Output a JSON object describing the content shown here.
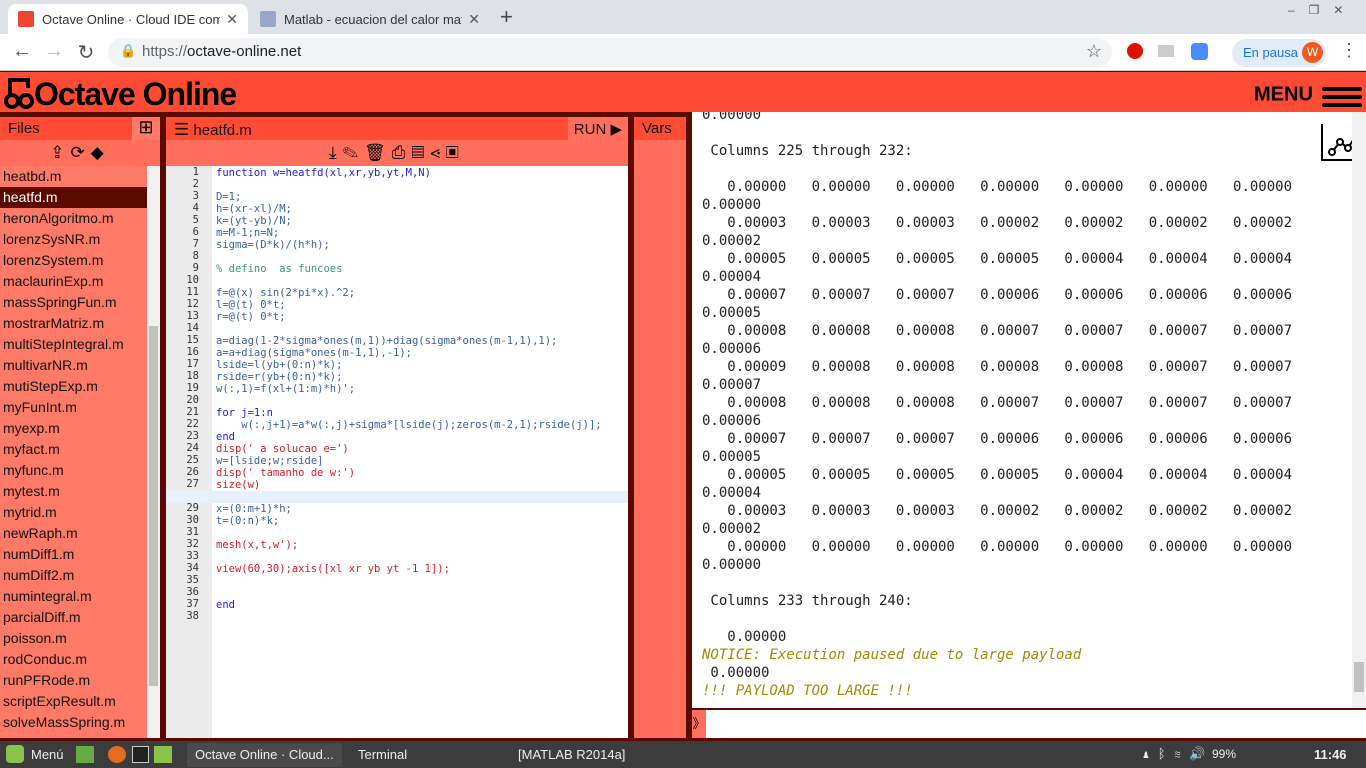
{
  "browser": {
    "tabs": [
      {
        "title": "Octave Online · Cloud IDE comp",
        "active": true
      },
      {
        "title": "Matlab - ecuacion del calor mat",
        "active": false
      }
    ],
    "url_scheme": "https://",
    "url_host": "octave-online.net",
    "profile_status": "En pausa",
    "avatar_letter": "W"
  },
  "app": {
    "logo": "Octave Online",
    "menu_label": "MENU",
    "accent": "#ff4b33"
  },
  "files": {
    "title": "Files",
    "items": [
      "heatbd.m",
      "heatfd.m",
      "heronAlgoritmo.m",
      "lorenzSysNR.m",
      "lorenzSystem.m",
      "maclaurinExp.m",
      "massSpringFun.m",
      "mostrarMatriz.m",
      "multiStepIntegral.m",
      "multivarNR.m",
      "mutiStepExp.m",
      "myFunInt.m",
      "myexp.m",
      "myfact.m",
      "myfunc.m",
      "mytest.m",
      "mytrid.m",
      "newRaph.m",
      "numDiff1.m",
      "numDiff2.m",
      "numintegral.m",
      "parcialDiff.m",
      "poisson.m",
      "rodConduc.m",
      "runPFRode.m",
      "scriptExpResult.m",
      "solveMassSpring.m"
    ],
    "selected": "heatfd.m"
  },
  "editor": {
    "filename": "heatfd.m",
    "run_label": "RUN",
    "current_line": 28,
    "lines": [
      "function w=heatfd(xl,xr,yb,yt,M,N)",
      "",
      "D=1;",
      "h=(xr-xl)/M;",
      "k=(yt-yb)/N;",
      "m=M-1;n=N;",
      "sigma=(D*k)/(h*h);",
      "",
      "% defino  as funcoes",
      "",
      "f=@(x) sin(2*pi*x).^2;",
      "l=@(t) 0*t;",
      "r=@(t) 0*t;",
      "",
      "a=diag(1-2*sigma*ones(m,1))+diag(sigma*ones(m-1,1),1);",
      "a=a+diag(sigma*ones(m-1,1),-1);",
      "lside=l(yb+(0:n)*k);",
      "rside=r(yb+(0:n)*k);",
      "w(:,1)=f(xl+(1:m)*h)';",
      "",
      "for j=1:n",
      "    w(:,j+1)=a*w(:,j)+sigma*[lside(j);zeros(m-2,1);rside(j)];",
      "end",
      "disp(' a solucao e=')",
      "w=[lside;w;rside]",
      "disp(' tamanho de w:')",
      "size(w)",
      "",
      "x=(0:m+1)*h;",
      "t=(0:n)*k;",
      "",
      "mesh(x,t,w');",
      "",
      "view(60,30);axis([xl xr yb yt -1 1]);",
      "",
      "",
      "end",
      ""
    ]
  },
  "vars": {
    "title": "Vars"
  },
  "output": {
    "lines": [
      "0.00000",
      "",
      " Columns 225 through 232:",
      "",
      "   0.00000   0.00000   0.00000   0.00000   0.00000   0.00000   0.00000",
      "0.00000",
      "   0.00003   0.00003   0.00003   0.00002   0.00002   0.00002   0.00002",
      "0.00002",
      "   0.00005   0.00005   0.00005   0.00005   0.00004   0.00004   0.00004",
      "0.00004",
      "   0.00007   0.00007   0.00007   0.00006   0.00006   0.00006   0.00006",
      "0.00005",
      "   0.00008   0.00008   0.00008   0.00007   0.00007   0.00007   0.00007",
      "0.00006",
      "   0.00009   0.00008   0.00008   0.00008   0.00008   0.00007   0.00007",
      "0.00007",
      "   0.00008   0.00008   0.00008   0.00007   0.00007   0.00007   0.00007",
      "0.00006",
      "   0.00007   0.00007   0.00007   0.00006   0.00006   0.00006   0.00006",
      "0.00005",
      "   0.00005   0.00005   0.00005   0.00005   0.00004   0.00004   0.00004",
      "0.00004",
      "   0.00003   0.00003   0.00003   0.00002   0.00002   0.00002   0.00002",
      "0.00002",
      "   0.00000   0.00000   0.00000   0.00000   0.00000   0.00000   0.00000",
      "0.00000",
      "",
      " Columns 233 through 240:",
      "",
      "   0.00000"
    ],
    "notices": [
      "NOTICE: Execution paused due to large payload",
      " 0.00000",
      "!!! PAYLOAD TOO LARGE !!!"
    ],
    "prompt_symbol": "》"
  },
  "taskbar": {
    "menu_label": "Menú",
    "items": [
      "Octave Online · Cloud...",
      "Terminal",
      "[MATLAB R2014a]"
    ],
    "battery": "99%",
    "clock": "11:46"
  }
}
